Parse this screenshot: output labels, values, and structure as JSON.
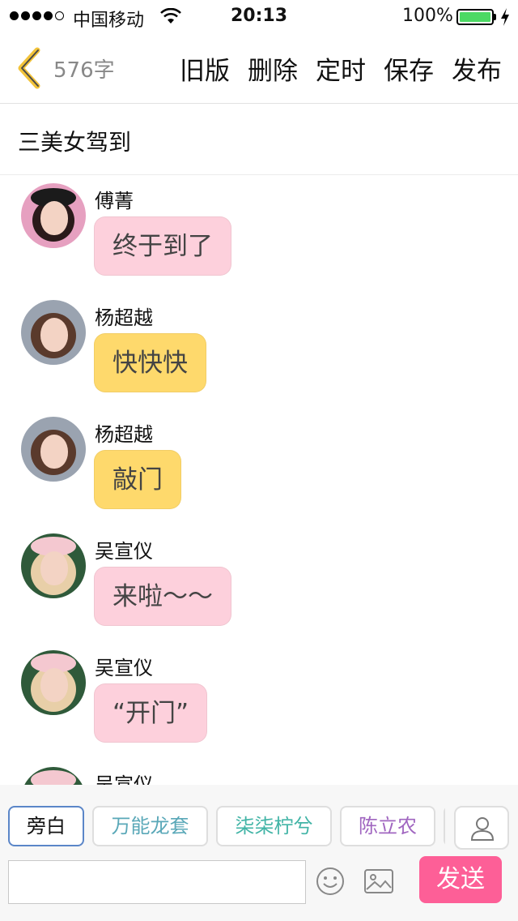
{
  "status_bar": {
    "carrier": "中国移动",
    "time": "20:13",
    "battery_percent": "100%",
    "battery_level": 1.0,
    "signal_bars_filled": 4,
    "signal_bars_total": 5
  },
  "nav": {
    "back_icon": "chevron-left-icon",
    "word_count": "576字",
    "actions": [
      "旧版",
      "删除",
      "定时",
      "保存",
      "发布"
    ]
  },
  "story": {
    "title": "三美女驾到"
  },
  "messages": [
    {
      "sender": "傅菁",
      "text": "终于到了",
      "bubble_color": "#fdd0dc",
      "avatar": "avatar-fujing"
    },
    {
      "sender": "杨超越",
      "text": "快快快",
      "bubble_color": "#fed96c",
      "avatar": "avatar-yangchaoyue"
    },
    {
      "sender": "杨超越",
      "text": "敲门",
      "bubble_color": "#fed96c",
      "avatar": "avatar-yangchaoyue"
    },
    {
      "sender": "吴宣仪",
      "text": "来啦～～",
      "bubble_color": "#fdd0dc",
      "avatar": "avatar-wuxuanyi"
    },
    {
      "sender": "吴宣仪",
      "text": "“开门”",
      "bubble_color": "#fdd0dc",
      "avatar": "avatar-wuxuanyi"
    },
    {
      "sender": "吴宣仪",
      "text": "",
      "bubble_color": "#fdd0dc",
      "avatar": "avatar-wuxuanyi"
    }
  ],
  "composer": {
    "roles": [
      "旁白",
      "万能龙套",
      "柒柒柠兮",
      "陈立农",
      ""
    ],
    "selected_role": "旁白",
    "input_value": "",
    "input_placeholder": "",
    "send_label": "发送",
    "colors": {
      "accent_send": "#fd5f97",
      "selected_border": "#5b86c8"
    }
  }
}
